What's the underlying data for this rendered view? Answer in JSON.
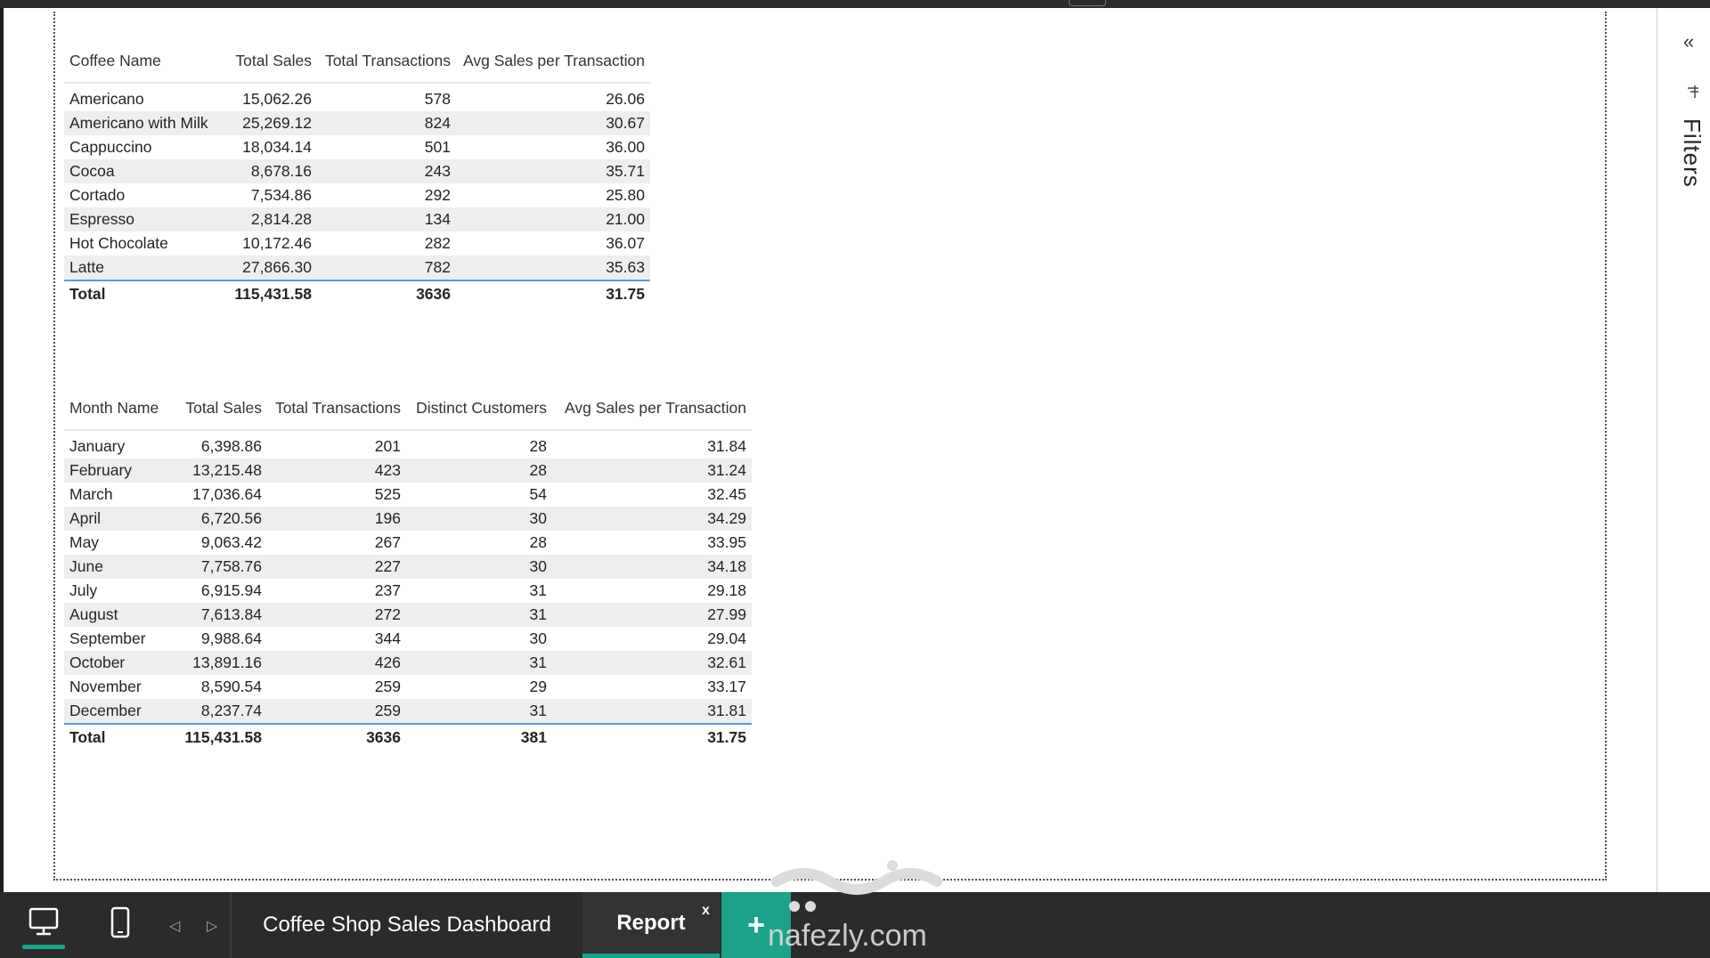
{
  "table_coffee": {
    "headers": [
      "Coffee Name",
      "Total Sales",
      "Total Transactions",
      "Avg Sales per Transaction"
    ],
    "rows": [
      [
        "Americano",
        "15,062.26",
        "578",
        "26.06"
      ],
      [
        "Americano with Milk",
        "25,269.12",
        "824",
        "30.67"
      ],
      [
        "Cappuccino",
        "18,034.14",
        "501",
        "36.00"
      ],
      [
        "Cocoa",
        "8,678.16",
        "243",
        "35.71"
      ],
      [
        "Cortado",
        "7,534.86",
        "292",
        "25.80"
      ],
      [
        "Espresso",
        "2,814.28",
        "134",
        "21.00"
      ],
      [
        "Hot Chocolate",
        "10,172.46",
        "282",
        "36.07"
      ],
      [
        "Latte",
        "27,866.30",
        "782",
        "35.63"
      ]
    ],
    "total": [
      "Total",
      "115,431.58",
      "3636",
      "31.75"
    ]
  },
  "table_month": {
    "headers": [
      "Month Name",
      "Total Sales",
      "Total Transactions",
      "Distinct Customers",
      "Avg Sales per Transaction"
    ],
    "rows": [
      [
        "January",
        "6,398.86",
        "201",
        "28",
        "31.84"
      ],
      [
        "February",
        "13,215.48",
        "423",
        "28",
        "31.24"
      ],
      [
        "March",
        "17,036.64",
        "525",
        "54",
        "32.45"
      ],
      [
        "April",
        "6,720.56",
        "196",
        "30",
        "34.29"
      ],
      [
        "May",
        "9,063.42",
        "267",
        "28",
        "33.95"
      ],
      [
        "June",
        "7,758.76",
        "227",
        "30",
        "34.18"
      ],
      [
        "July",
        "6,915.94",
        "237",
        "31",
        "29.18"
      ],
      [
        "August",
        "7,613.84",
        "272",
        "31",
        "27.99"
      ],
      [
        "September",
        "9,988.64",
        "344",
        "30",
        "29.04"
      ],
      [
        "October",
        "13,891.16",
        "426",
        "31",
        "32.61"
      ],
      [
        "November",
        "8,590.54",
        "259",
        "29",
        "33.17"
      ],
      [
        "December",
        "8,237.74",
        "259",
        "31",
        "31.81"
      ]
    ],
    "total": [
      "Total",
      "115,431.58",
      "3636",
      "381",
      "31.75"
    ]
  },
  "filters_pane": {
    "label": "Filters",
    "collapse_icon": "double-chevron-left-icon"
  },
  "bottom_bar": {
    "tabs": [
      "Coffee Shop Sales Dashboard",
      "Report"
    ],
    "active_tab": "Report",
    "close_label": "x",
    "add_label": "+",
    "accent_color": "#1aa38a"
  },
  "watermark": {
    "text": "nafezly.com"
  }
}
